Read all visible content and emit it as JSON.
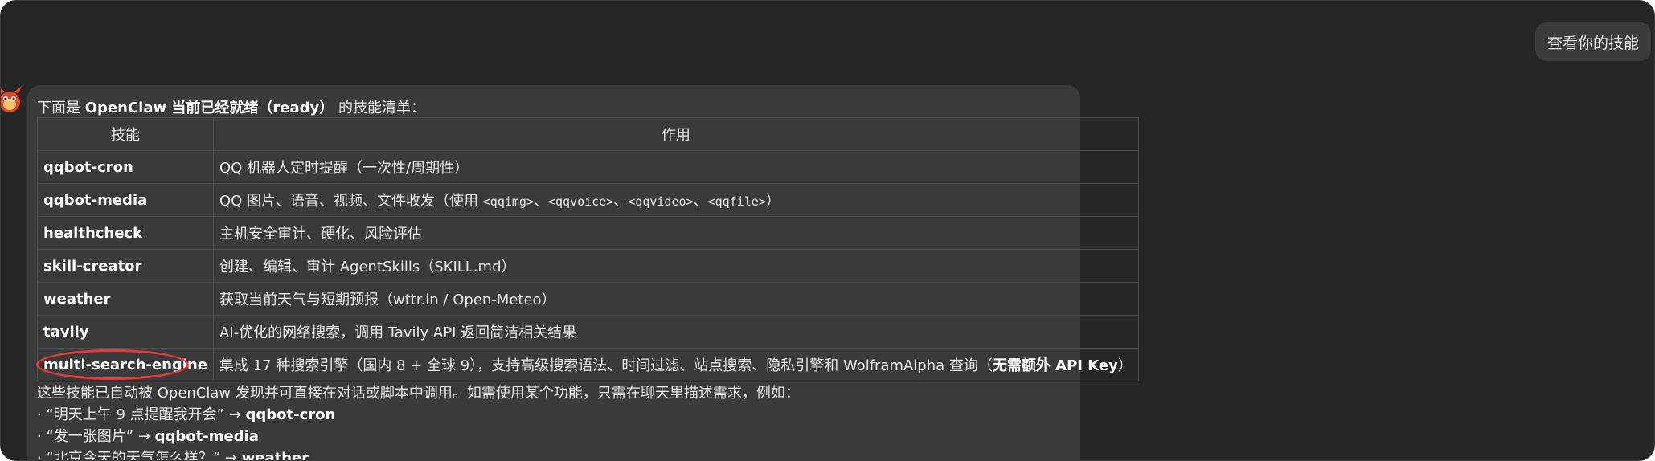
{
  "user_message": "查看你的技能",
  "intro": {
    "prefix": "下面是 ",
    "bold": "OpenClaw 当前已经就绪（ready）",
    "suffix": " 的技能清单："
  },
  "table": {
    "headers": [
      "技能",
      "作用"
    ],
    "rows": [
      {
        "name": "qqbot-cron",
        "desc": "QQ 机器人定时提醒（一次性/周期性）"
      },
      {
        "name": "qqbot-media",
        "desc_prefix": "QQ 图片、语音、视频、文件收发（使用 ",
        "tags": [
          "<qqimg>",
          "<qqvoice>",
          "<qqvideo>",
          "<qqfile>"
        ],
        "sep": "、",
        "desc_suffix": "）"
      },
      {
        "name": "healthcheck",
        "desc": "主机安全审计、硬化、风险评估"
      },
      {
        "name": "skill-creator",
        "desc": "创建、编辑、审计 AgentSkills（SKILL.md）"
      },
      {
        "name": "weather",
        "desc": "获取当前天气与短期预报（wttr.in / Open-Meteo）"
      },
      {
        "name": "tavily",
        "desc": "AI-优化的网络搜索，调用 Tavily API 返回简洁相关结果"
      },
      {
        "name": "multi-search-engine",
        "desc_prefix": "集成 17 种搜索引擎（国内 8 + 全球 9），支持高级搜索语法、时间过滤、站点搜索、隐私引擎和 WolframAlpha 查询（",
        "desc_strong": "无需额外 API Key",
        "desc_suffix": "）"
      }
    ]
  },
  "outro": {
    "line1": "这些技能已自动被 OpenClaw 发现并可直接在对话或脚本中调用。如需使用某个功能，只需在聊天里描述需求，例如：",
    "examples": [
      {
        "quote": "· “明天上午 9 点提醒我开会” → ",
        "skill": "qqbot-cron"
      },
      {
        "quote": "· “发一张图片” → ",
        "skill": "qqbot-media"
      },
      {
        "quote": "· “北京今天的天气怎么样？” → ",
        "skill": "weather"
      }
    ]
  },
  "colors": {
    "background": "#262626",
    "bubble": "#3a3a3a",
    "highlight": "#e23c3c"
  }
}
